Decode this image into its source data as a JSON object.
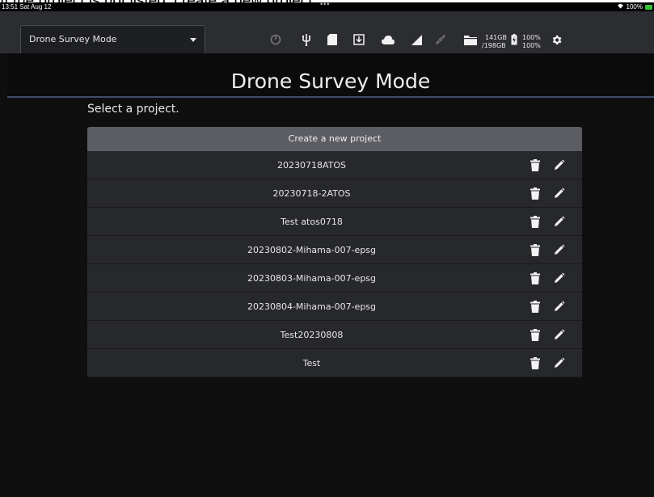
{
  "caption": "If the project is not listed, create a new project.",
  "statusbar": {
    "time": "13:51  Sat Aug 12",
    "battery": "100%"
  },
  "toolbar": {
    "mode_value": "Drone Survey Mode",
    "icons": [
      "timer-icon",
      "usb-icon",
      "sd-card-icon",
      "download-icon",
      "cloud-icon",
      "signal-icon",
      "satellite-icon",
      "folder-icon",
      "battery-icon",
      "settings-icon"
    ],
    "storage_used": "141GB",
    "storage_total": "/198GB",
    "battery_1": "100%",
    "battery_2": "100%"
  },
  "page": {
    "title": "Drone Survey Mode",
    "prompt": "Select a project.",
    "create_label": "Create a new project"
  },
  "projects": [
    "20230718ATOS",
    "20230718-2ATOS",
    "Test atos0718",
    "20230802-Mihama-007-epsg",
    "20230803-Mihama-007-epsg",
    "20230804-Mihama-007-epsg",
    "Test20230808",
    "Test"
  ],
  "colors": {
    "toolbar_bg": "#2c2d31",
    "page_bg": "#0f0f10",
    "row_bg": "#27282c",
    "create_bg": "#5c5d62",
    "accent_line": "#3f4c6a"
  }
}
